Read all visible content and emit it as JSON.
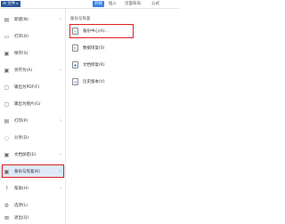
{
  "topbar": {
    "file_label": "文件",
    "start_tab": "开始",
    "tabs": [
      "插入",
      "页面布局",
      "公式"
    ]
  },
  "menu": {
    "items": [
      {
        "label": "新建(N)",
        "icon": "new-icon",
        "glyph": "▤"
      },
      {
        "label": "打开(O)",
        "icon": "open-icon",
        "glyph": "▭"
      },
      {
        "label": "保存(S)",
        "icon": "save-icon",
        "glyph": "▣"
      },
      {
        "label": "另存为(A)",
        "icon": "save-as-icon",
        "glyph": "▣"
      },
      {
        "label": "输出为PDF(F)",
        "icon": "pdf-icon",
        "glyph": "▢"
      },
      {
        "label": "输出为图片(G)",
        "icon": "image-icon",
        "glyph": "▢"
      },
      {
        "label": "打印(P)",
        "icon": "print-icon",
        "glyph": "▤"
      },
      {
        "label": "分享(D)",
        "icon": "share-icon",
        "glyph": "◌"
      },
      {
        "label": "文档加密(E)",
        "icon": "encrypt-icon",
        "glyph": "▣"
      },
      {
        "label": "备份与恢复(K)",
        "icon": "backup-icon",
        "glyph": "▣"
      },
      {
        "label": "帮助(H)",
        "icon": "help-icon",
        "glyph": "?"
      },
      {
        "label": "选项(L)",
        "icon": "options-icon",
        "glyph": "⚙"
      },
      {
        "label": "退出(Q)",
        "icon": "exit-icon",
        "glyph": "⊠"
      }
    ]
  },
  "submenu": {
    "header": "备份与恢复",
    "items": [
      {
        "label": "备份中心(A)...",
        "icon": "backup-center-icon"
      },
      {
        "label": "数据恢复(S)",
        "icon": "data-recovery-icon"
      },
      {
        "label": "文档修复(R)",
        "icon": "doc-repair-icon"
      },
      {
        "label": "历史版本(V)",
        "icon": "history-version-icon"
      }
    ]
  },
  "colors": {
    "accent": "#2b579a",
    "start_tab": "#3a7ee8",
    "highlight_border": "#e02020",
    "selected_bg": "#dfe9f7"
  }
}
